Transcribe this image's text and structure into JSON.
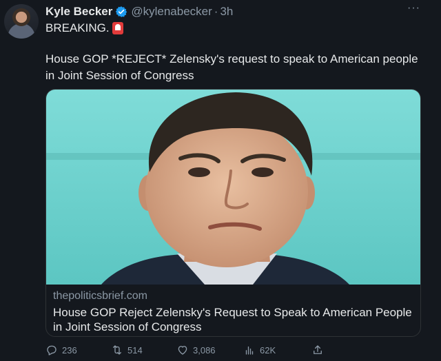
{
  "tweet": {
    "author_name": "Kyle Becker",
    "handle": "@kylenabecker",
    "separator": "·",
    "time": "3h",
    "more_label": "···",
    "breaking_text": "BREAKING.",
    "body": "House GOP *REJECT* Zelensky's request to speak to American people in Joint Session of Congress"
  },
  "card": {
    "domain": "thepoliticsbrief.com",
    "title": "House GOP Reject Zelensky's Request to Speak to American People in Joint Session of Congress"
  },
  "actions": {
    "replies": "236",
    "retweets": "514",
    "likes": "3,086",
    "views": "62K"
  },
  "colors": {
    "background": "#14181e",
    "secondary_text": "#8b98a5",
    "verified": "#1d9bf0",
    "siren": "#e23b3b",
    "card_backdrop": "#6fd3d0"
  },
  "icons": [
    "verified-badge-icon",
    "siren-emoji-icon",
    "reply-icon",
    "retweet-icon",
    "like-icon",
    "views-icon",
    "share-icon",
    "more-icon"
  ]
}
